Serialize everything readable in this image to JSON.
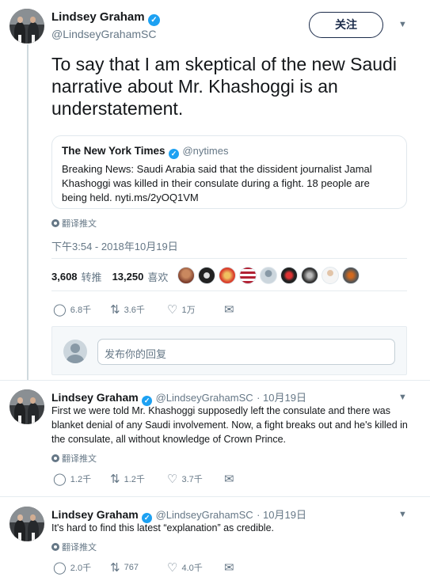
{
  "main_tweet": {
    "name": "Lindsey Graham",
    "handle": "@LindseyGrahamSC",
    "follow_label": "关注",
    "text": "To say that I am skeptical of the new Saudi narrative about Mr. Khashoggi is an understatement.",
    "quoted": {
      "name": "The New York Times",
      "handle": "@nytimes",
      "text": "Breaking News: Saudi Arabia said that the dissident journalist Jamal Khashoggi was killed in their consulate during a fight. 18 people are being held. nyti.ms/2yOQ1VM"
    },
    "translate_label": "翻译推文",
    "timestamp": "下午3:54 - 2018年10月19日",
    "retweets_count": "3,608",
    "retweets_label": "转推",
    "likes_count": "13,250",
    "likes_label": "喜欢",
    "replies": "6.8千",
    "rts": "3.6千",
    "likes": "1万",
    "reply_placeholder": "发布你的回复"
  },
  "replies": [
    {
      "name": "Lindsey Graham",
      "handle": "@LindseyGrahamSC",
      "date": "· 10月19日",
      "text": "First we were told Mr. Khashoggi supposedly left the consulate and there was blanket denial of any Saudi involvement.  Now, a fight breaks out and he's killed in the consulate, all without knowledge of Crown Prince.",
      "translate_label": "翻译推文",
      "replies": "1.2千",
      "rts": "1.2千",
      "likes": "3.7千"
    },
    {
      "name": "Lindsey Graham",
      "handle": "@LindseyGrahamSC",
      "date": "· 10月19日",
      "text": "It's hard to find this latest “explanation” as credible.",
      "translate_label": "翻译推文",
      "replies": "2.0千",
      "rts": "767",
      "likes": "4.0千"
    }
  ],
  "colors": {
    "verified": "#1da1f2",
    "follow_border": "#1b2b4a",
    "muted": "#657786",
    "text": "#14171a"
  },
  "icons": {
    "verified": "verified-badge-icon",
    "reply": "reply-icon",
    "retweet": "retweet-icon",
    "like": "heart-icon",
    "dm": "envelope-icon",
    "translate": "globe-icon",
    "caret": "chevron-down-icon"
  }
}
